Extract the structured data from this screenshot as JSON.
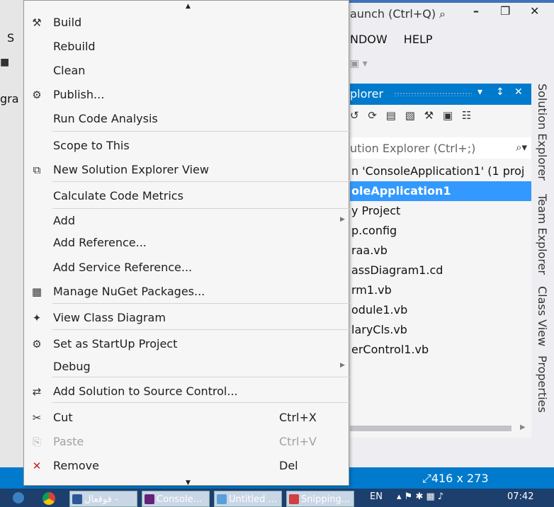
{
  "background": {
    "launch_search": "aunch (Ctrl+Q)",
    "menu_window": "NDOW",
    "menu_help": "HELP",
    "left_fragment": "S",
    "left_fragment2": "gra",
    "solution_explorer": {
      "title": "plorer",
      "search_placeholder": "ution Explorer (Ctrl+;)",
      "tree": [
        "n 'ConsoleApplication1' (1 proj",
        "oleApplication1",
        "y Project",
        "p.config",
        "raa.vb",
        "assDiagram1.cd",
        "rm1.vb",
        "odule1.vb",
        "laryCls.vb",
        "erControl1.vb"
      ],
      "selected_index": 1
    },
    "side_tabs": [
      "Solution Explorer",
      "Team Explorer",
      "Class View",
      "Properties"
    ],
    "status_dimensions": "416 x 273",
    "taskbar": {
      "items": [
        "فوقعال -",
        "Console...",
        "Untitled ...",
        "Snipping..."
      ],
      "lang": "EN",
      "clock": "07:42"
    },
    "accent": "#007acc"
  },
  "menu": {
    "items": [
      {
        "label": "Build",
        "icon": "build-icon",
        "glyph": "⚒",
        "shortcut": "",
        "submenu": false,
        "disabled": false
      },
      {
        "label": "Rebuild",
        "icon": "",
        "glyph": "",
        "shortcut": "",
        "submenu": false,
        "disabled": false
      },
      {
        "label": "Clean",
        "icon": "",
        "glyph": "",
        "shortcut": "",
        "submenu": false,
        "disabled": false
      },
      {
        "label": "Publish...",
        "icon": "publish-globe-icon",
        "glyph": "⚙",
        "shortcut": "",
        "submenu": false,
        "disabled": false
      },
      {
        "label": "Run Code Analysis",
        "icon": "",
        "glyph": "",
        "shortcut": "",
        "submenu": false,
        "disabled": false
      },
      {
        "label": "Scope to This",
        "icon": "",
        "glyph": "",
        "shortcut": "",
        "submenu": false,
        "disabled": false
      },
      {
        "label": "New Solution Explorer View",
        "icon": "new-view-icon",
        "glyph": "⧉",
        "shortcut": "",
        "submenu": false,
        "disabled": false
      },
      {
        "label": "Calculate Code Metrics",
        "icon": "",
        "glyph": "",
        "shortcut": "",
        "submenu": false,
        "disabled": false
      },
      {
        "label": "Add",
        "icon": "",
        "glyph": "",
        "shortcut": "",
        "submenu": true,
        "disabled": false
      },
      {
        "label": "Add Reference...",
        "icon": "",
        "glyph": "",
        "shortcut": "",
        "submenu": false,
        "disabled": false
      },
      {
        "label": "Add Service Reference...",
        "icon": "",
        "glyph": "",
        "shortcut": "",
        "submenu": false,
        "disabled": false
      },
      {
        "label": "Manage NuGet Packages...",
        "icon": "nuget-icon",
        "glyph": "▦",
        "shortcut": "",
        "submenu": false,
        "disabled": false
      },
      {
        "label": "View Class Diagram",
        "icon": "class-diagram-icon",
        "glyph": "✦",
        "shortcut": "",
        "submenu": false,
        "disabled": false
      },
      {
        "label": "Set as StartUp Project",
        "icon": "gear-icon",
        "glyph": "⚙",
        "shortcut": "",
        "submenu": false,
        "disabled": false
      },
      {
        "label": "Debug",
        "icon": "",
        "glyph": "",
        "shortcut": "",
        "submenu": true,
        "disabled": false
      },
      {
        "label": "Add Solution to Source Control...",
        "icon": "source-control-icon",
        "glyph": "⇄",
        "shortcut": "",
        "submenu": false,
        "disabled": false
      },
      {
        "label": "Cut",
        "icon": "scissors-icon",
        "glyph": "✂",
        "shortcut": "Ctrl+X",
        "submenu": false,
        "disabled": false
      },
      {
        "label": "Paste",
        "icon": "paste-icon",
        "glyph": "⎘",
        "shortcut": "Ctrl+V",
        "submenu": false,
        "disabled": true
      },
      {
        "label": "Remove",
        "icon": "remove-x-icon",
        "glyph": "✕",
        "shortcut": "Del",
        "submenu": false,
        "disabled": false
      }
    ]
  }
}
